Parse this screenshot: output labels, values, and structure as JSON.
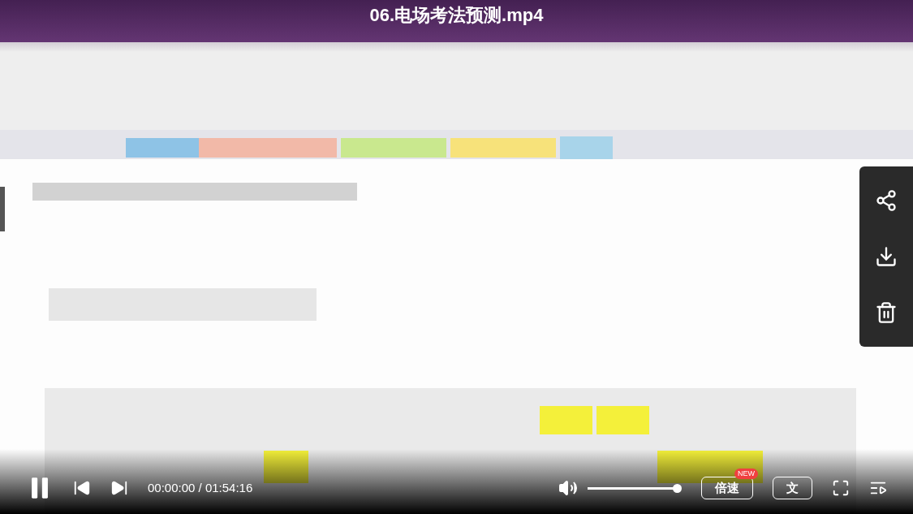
{
  "video": {
    "title": "06.电场考法预测.mp4"
  },
  "side_panel": {
    "actions": [
      {
        "kind": "share"
      },
      {
        "kind": "download"
      },
      {
        "kind": "delete"
      }
    ]
  },
  "controls": {
    "playing": true,
    "time": "00:00:00 / 01:54:16",
    "volume": {
      "level": 1
    },
    "speed_button": {
      "label": "倍速",
      "badge": "NEW"
    },
    "text_button": {
      "label": "文"
    }
  }
}
